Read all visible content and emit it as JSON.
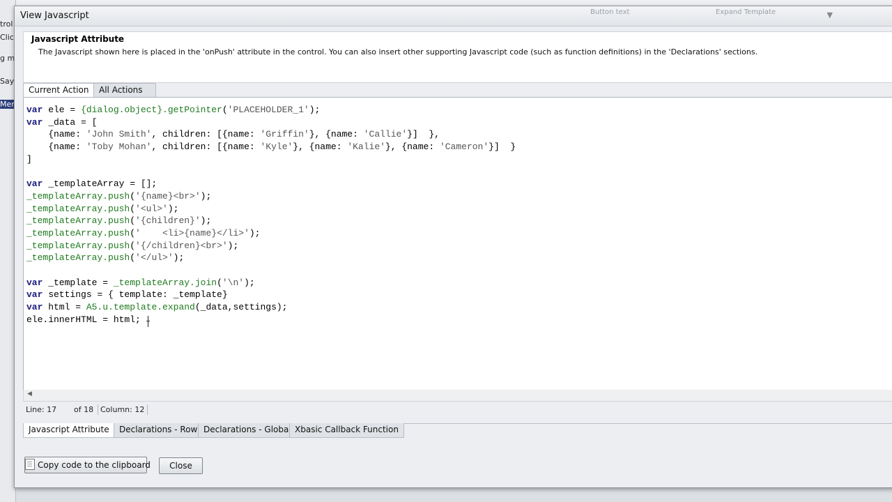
{
  "background": {
    "left_fragments": [
      "trol",
      "Click",
      "g m",
      "Say",
      "Merc"
    ],
    "top_fragments": [
      "Button text",
      "Expand Template"
    ]
  },
  "dialog": {
    "title": "View Javascript",
    "header_title": "Javascript Attribute",
    "header_description": "The Javascript shown here is placed in the 'onPush' attribute in the control. You can also insert other supporting Javascript code (such as function definitions) in the 'Declarations' sections."
  },
  "top_tabs": [
    {
      "label": "Current Action",
      "active": true
    },
    {
      "label": "All Actions",
      "active": false
    }
  ],
  "code_lines": [
    "var ele = {dialog.object}.getPointer('PLACEHOLDER_1');",
    "var _data = [",
    "    {name: 'John Smith', children: [{name: 'Griffin'}, {name: 'Callie'}]  },",
    "    {name: 'Toby Mohan', children: [{name: 'Kyle'}, {name: 'Kalie'}, {name: 'Cameron'}]  }",
    "]",
    "",
    "var _templateArray = [];",
    "_templateArray.push('{name}<br>');",
    "_templateArray.push('<ul>');",
    "_templateArray.push('{children}');",
    "_templateArray.push('    <li>{name}</li>');",
    "_templateArray.push('{/children}<br>');",
    "_templateArray.push('</ul>');",
    "",
    "var _template = _templateArray.join('\\n');",
    "var settings = { template: _template}",
    "var html = A5.u.template.expand(_data,settings);",
    "ele.innerHTML = html;"
  ],
  "status": {
    "line": "Line: 17",
    "of": "of 18",
    "column": "Column: 12"
  },
  "bottom_tabs": [
    {
      "label": "Javascript Attribute",
      "active": true
    },
    {
      "label": "Declarations - Row",
      "active": false
    },
    {
      "label": "Declarations - Global",
      "active": false
    },
    {
      "label": "Xbasic Callback Function",
      "active": false
    }
  ],
  "buttons": {
    "copy": "Copy code to the clipboard",
    "close": "Close"
  }
}
